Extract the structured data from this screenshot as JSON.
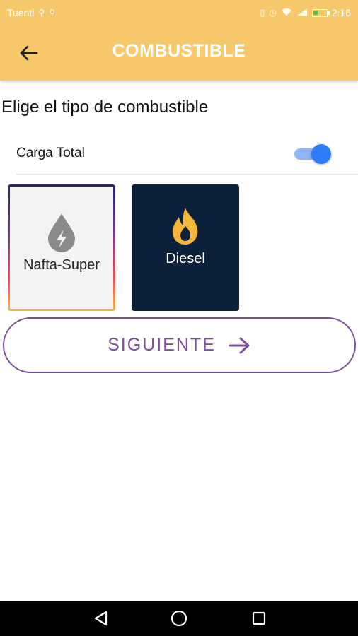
{
  "status_bar": {
    "carrier": "Tuenti",
    "time": "2:16",
    "battery_level": 0.35
  },
  "app_bar": {
    "title": "COMBUSTIBLE",
    "back_icon": "arrow-left-icon",
    "background_color": "#f8c96a"
  },
  "main": {
    "heading": "Elige el tipo de combustible",
    "toggle": {
      "label": "Carga Total",
      "on": true
    },
    "fuel_options": [
      {
        "label": "Nafta-Super",
        "icon": "fuel-drop-bolt-icon",
        "selected": true
      },
      {
        "label": "Diesel",
        "icon": "flame-icon",
        "selected": false
      }
    ],
    "next_button": {
      "label": "SIGUIENTE",
      "icon": "arrow-right-icon",
      "color": "#7e4fa0"
    }
  },
  "nav_bar": {
    "back_icon": "triangle-back-icon",
    "home_icon": "circle-home-icon",
    "recents_icon": "square-recents-icon"
  }
}
